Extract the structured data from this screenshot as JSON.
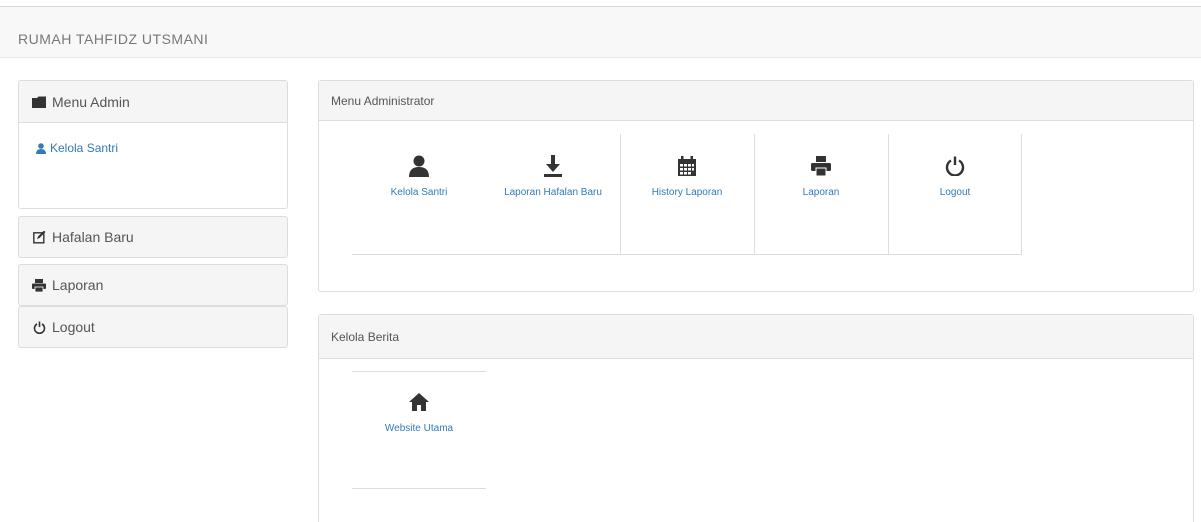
{
  "brand": "RUMAH TAHFIDZ UTSMANI",
  "sidebar": {
    "menu_admin": {
      "title": "Menu Admin",
      "links": [
        {
          "label": "Kelola Santri",
          "icon": "user-icon"
        }
      ]
    },
    "items": [
      {
        "label": "Hafalan Baru",
        "icon": "edit-icon"
      },
      {
        "label": "Laporan",
        "icon": "print-icon"
      },
      {
        "label": "Logout",
        "icon": "power-icon"
      }
    ]
  },
  "admin_panel": {
    "title": "Menu Administrator",
    "tiles": [
      {
        "label": "Kelola Santri",
        "icon": "user-icon"
      },
      {
        "label": "Laporan Hafalan Baru",
        "icon": "download-icon"
      },
      {
        "label": "History Laporan",
        "icon": "calendar-icon"
      },
      {
        "label": "Laporan",
        "icon": "print-icon"
      },
      {
        "label": "Logout",
        "icon": "power-icon"
      }
    ]
  },
  "news_panel": {
    "title": "Kelola Berita",
    "tiles": [
      {
        "label": "Website Utama",
        "icon": "home-icon"
      }
    ]
  },
  "colors": {
    "link": "#337ab7",
    "icon": "#333333",
    "panel_header": "#f5f5f5",
    "border": "#dddddd"
  }
}
